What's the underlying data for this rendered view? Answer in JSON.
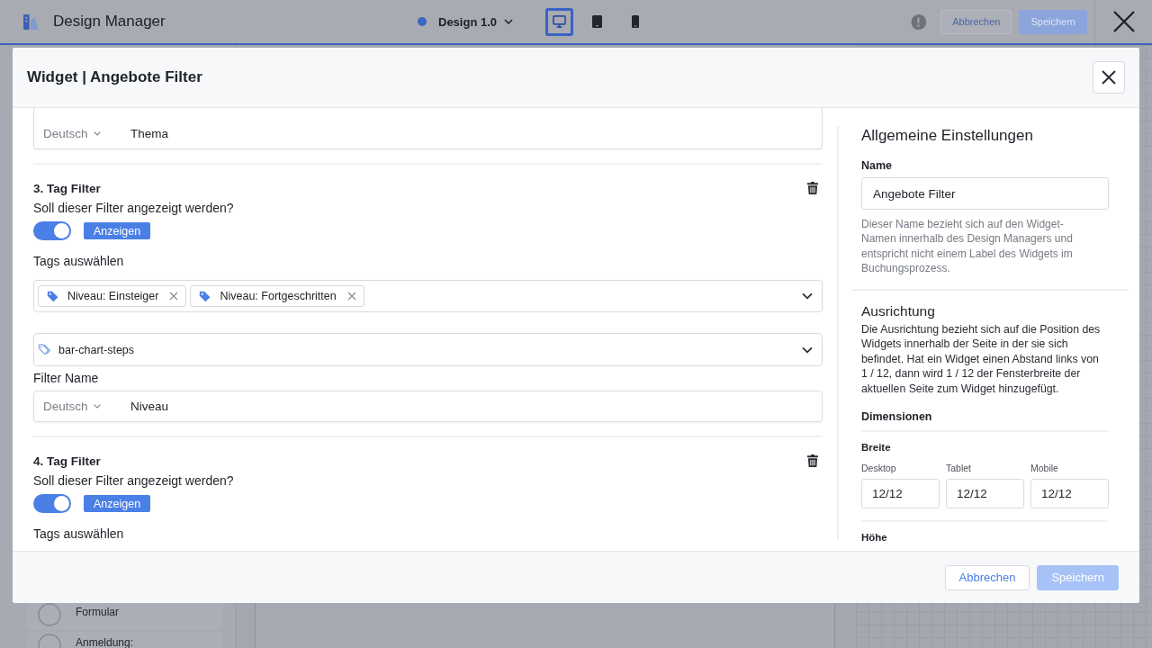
{
  "app_bar": {
    "title": "Design Manager",
    "design": {
      "label": "Design 1.0",
      "color": "#3f66c4"
    },
    "devices": [
      {
        "kind": "desktop",
        "selected": true
      },
      {
        "kind": "tablet",
        "selected": false
      },
      {
        "kind": "mobile",
        "selected": false
      }
    ],
    "buttons": [
      {
        "label": "Abbrechen",
        "kind": "secondary",
        "disabled": true
      },
      {
        "label": "Speichern",
        "kind": "primary",
        "disabled": true
      }
    ]
  },
  "sidebar": {
    "steps": [
      {
        "label": "Formular"
      },
      {
        "label": "Anmeldung:"
      }
    ]
  },
  "dialog": {
    "title": "Widget | Angebote Filter",
    "previous_filter_name": {
      "language": "Deutsch",
      "value": "Thema"
    },
    "filters": [
      {
        "title": "3. Tag Filter",
        "question": "Soll dieser Filter angezeigt werden?",
        "on": true,
        "on_label": "Anzeigen",
        "tags_label": "Tags auswählen",
        "tags": [
          {
            "label": "Niveau: Einsteiger"
          },
          {
            "label": "Niveau: Fortgeschritten"
          }
        ],
        "icon": "bar-chart-steps",
        "name_label": "Filter Name",
        "name": {
          "language": "Deutsch",
          "value": "Niveau"
        }
      },
      {
        "title": "4. Tag Filter",
        "question": "Soll dieser Filter angezeigt werden?",
        "on": true,
        "on_label": "Anzeigen",
        "tags_label": "Tags auswählen"
      }
    ],
    "settings": {
      "title": "Allgemeine Einstellungen",
      "name_label": "Name",
      "name_value": "Angebote Filter",
      "name_hint": "Dieser Name bezieht sich auf den Widget-Namen innerhalb des Design Managers und entspricht nicht einem Label des Widgets im Buchungsprozess.",
      "alignment_title": "Ausrichtung",
      "alignment_text": "Die Ausrichtung bezieht sich auf die Position des Widgets innerhalb der Seite in der sie sich befindet. Hat ein Widget einen Abstand links von 1 / 12, dann wird 1 / 12 der Fensterbreite der aktuellen Seite zum Widget hinzugefügt.",
      "dimensions_title": "Dimensionen",
      "width_label": "Breite",
      "widths": [
        {
          "label": "Desktop",
          "value": "12/12"
        },
        {
          "label": "Tablet",
          "value": "12/12"
        },
        {
          "label": "Mobile",
          "value": "12/12"
        }
      ],
      "height_label": "Höhe"
    },
    "buttons": [
      {
        "label": "Abbrechen",
        "kind": "secondary",
        "disabled": false
      },
      {
        "label": "Speichern",
        "kind": "primary",
        "disabled": true
      }
    ]
  }
}
